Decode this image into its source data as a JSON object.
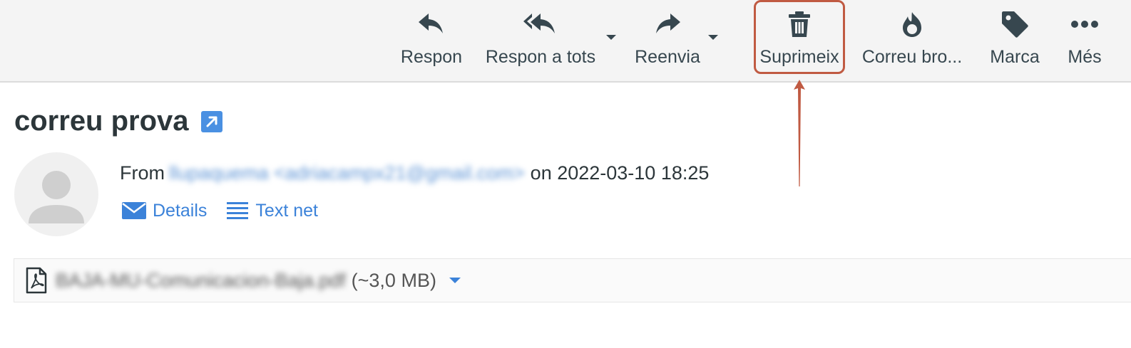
{
  "toolbar": {
    "reply": {
      "label": "Respon",
      "icon": "reply-icon"
    },
    "reply_all": {
      "label": "Respon a tots",
      "icon": "reply-all-icon"
    },
    "forward": {
      "label": "Reenvia",
      "icon": "forward-icon"
    },
    "delete": {
      "label": "Suprimeix",
      "icon": "trash-icon"
    },
    "junk": {
      "label": "Correu bro...",
      "icon": "fire-icon"
    },
    "mark": {
      "label": "Marca",
      "icon": "tag-icon"
    },
    "more": {
      "label": "Més",
      "icon": "ellipsis-icon"
    }
  },
  "message": {
    "subject": "correu prova",
    "from_label": "From",
    "from_address": "llupaquema <adriacampx21@gmail.com>",
    "date_text": "on 2022-03-10 18:25",
    "details_label": "Details",
    "plaintext_label": "Text net"
  },
  "attachment": {
    "filename": "BAJA-MU-Comunicacion-Baja.pdf",
    "size": "(~3,0 MB)"
  },
  "colors": {
    "accent": "#3b82d9",
    "highlight": "#c05a42",
    "toolbar_bg": "#f4f4f4"
  }
}
